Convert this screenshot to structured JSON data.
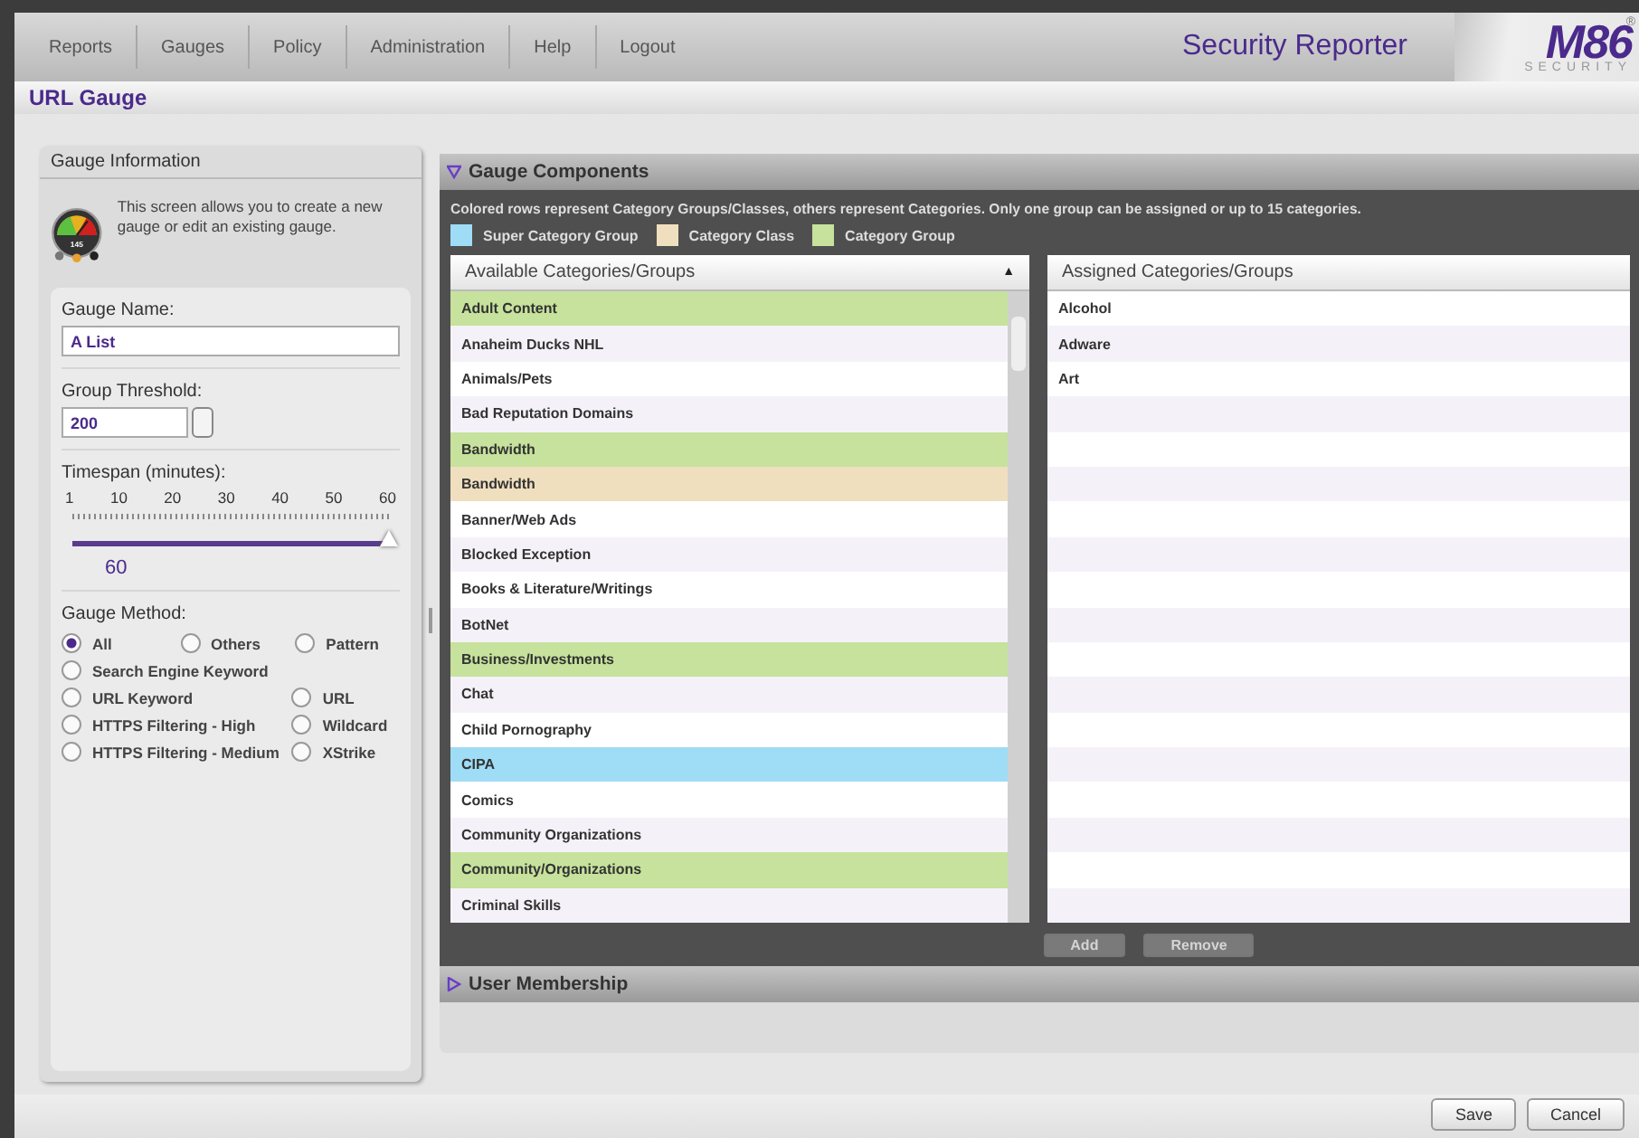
{
  "nav": {
    "items": [
      "Reports",
      "Gauges",
      "Policy",
      "Administration",
      "Help",
      "Logout"
    ],
    "product": "Security Reporter",
    "logo": {
      "mark": "M86",
      "sub": "SECURITY",
      "reg": "®"
    }
  },
  "page_title": "URL Gauge",
  "gauge_info": {
    "title": "Gauge Information",
    "gauge_value": "145",
    "description": "This screen allows you to create a new gauge or edit an existing gauge.",
    "name_label": "Gauge Name:",
    "name_value": "A List",
    "threshold_label": "Group Threshold:",
    "threshold_value": "200",
    "timespan_label": "Timespan (minutes):",
    "timespan_ticks": [
      "1",
      "10",
      "20",
      "30",
      "40",
      "50",
      "60"
    ],
    "timespan_slider": {
      "level": 1
    },
    "timespan_reading": "60",
    "method_label": "Gauge Method:",
    "method_rows": [
      [
        {
          "label": "All",
          "selected": true
        },
        {
          "label": "Others",
          "selected": false
        },
        {
          "label": "Pattern",
          "selected": false
        }
      ],
      [
        {
          "label": "Search Engine Keyword",
          "selected": false
        }
      ],
      [
        {
          "label": "URL Keyword",
          "selected": false
        },
        {
          "label": "URL",
          "selected": false
        }
      ],
      [
        {
          "label": "HTTPS Filtering - High",
          "selected": false
        },
        {
          "label": "Wildcard",
          "selected": false
        }
      ],
      [
        {
          "label": "HTTPS Filtering - Medium",
          "selected": false
        },
        {
          "label": "XStrike",
          "selected": false
        }
      ]
    ]
  },
  "components": {
    "title": "Gauge Components",
    "expanded": true,
    "note": "Colored rows represent Category Groups/Classes, others represent Categories.  Only one group can be assigned or up to 15 categories.",
    "legend": [
      {
        "label": "Super Category Group",
        "color": "#9fdcf5"
      },
      {
        "label": "Category Class",
        "color": "#f0dfbf"
      },
      {
        "label": "Category Group",
        "color": "#c6e29c"
      }
    ],
    "available": {
      "header": "Available Categories/Groups",
      "sort_glyph": "▲",
      "rows": [
        {
          "label": "Adult Content",
          "kind": "group"
        },
        {
          "label": "Anaheim Ducks NHL",
          "kind": "category"
        },
        {
          "label": "Animals/Pets",
          "kind": "category"
        },
        {
          "label": "Bad Reputation Domains",
          "kind": "category"
        },
        {
          "label": "Bandwidth",
          "kind": "group"
        },
        {
          "label": "Bandwidth",
          "kind": "class"
        },
        {
          "label": "Banner/Web Ads",
          "kind": "category"
        },
        {
          "label": "Blocked Exception",
          "kind": "category"
        },
        {
          "label": "Books & Literature/Writings",
          "kind": "category"
        },
        {
          "label": "BotNet",
          "kind": "category"
        },
        {
          "label": "Business/Investments",
          "kind": "group"
        },
        {
          "label": "Chat",
          "kind": "category"
        },
        {
          "label": "Child Pornography",
          "kind": "category"
        },
        {
          "label": "CIPA",
          "kind": "super"
        },
        {
          "label": "Comics",
          "kind": "category"
        },
        {
          "label": "Community Organizations",
          "kind": "category"
        },
        {
          "label": "Community/Organizations",
          "kind": "group"
        },
        {
          "label": "Criminal Skills",
          "kind": "category"
        }
      ]
    },
    "assigned": {
      "header": "Assigned Categories/Groups",
      "rows": [
        "Alcohol",
        "Adware",
        "Art"
      ]
    },
    "add_button": {
      "label": "Add",
      "disabled": true
    },
    "remove_button": {
      "label": "Remove",
      "disabled": true
    }
  },
  "membership": {
    "title": "User Membership",
    "expanded": false
  },
  "buttons": [
    "Save",
    "Cancel"
  ]
}
